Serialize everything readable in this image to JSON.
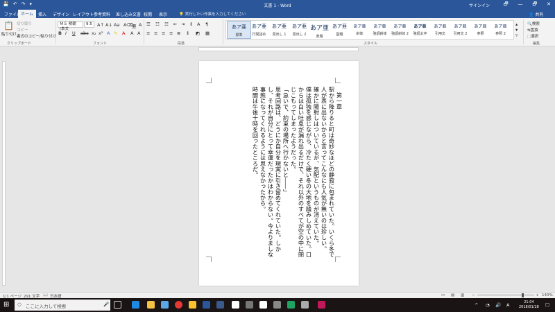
{
  "window": {
    "title": "文書 1 - Word",
    "signin": "サインイン",
    "share_label": "共有"
  },
  "quick_access": [
    "💾",
    "↶",
    "↷",
    "▾"
  ],
  "window_buttons": [
    "🗗",
    "—",
    "🗗",
    "✕"
  ],
  "tabs": [
    "ファイル",
    "ホーム",
    "挿入",
    "デザイン",
    "レイアウト",
    "参考資料",
    "差し込み文書",
    "校閲",
    "表示"
  ],
  "tell_me": "実行したい作業を入力してください",
  "ribbon": {
    "clipboard": {
      "paste": "貼り付け",
      "cut": "切り取り",
      "copy": "コピー",
      "format_painter": "書式のコピー/貼り付け",
      "group": "クリップボード"
    },
    "font": {
      "name": "ＭＳ 明朝 (本文",
      "size": "9.5",
      "group": "フォント"
    },
    "paragraph": {
      "group": "段落"
    },
    "styles": {
      "group": "スタイル",
      "items": [
        {
          "sample": "あア亜",
          "name": "標準"
        },
        {
          "sample": "あア亜",
          "name": "行間詰め"
        },
        {
          "sample": "あア亜",
          "name": "見出し 1"
        },
        {
          "sample": "あア亜",
          "name": "見出し 2"
        },
        {
          "sample": "あア亜",
          "name": "表題"
        },
        {
          "sample": "あア亜",
          "name": "副題"
        },
        {
          "sample": "あア亜",
          "name": "斜体"
        },
        {
          "sample": "あア亜",
          "name": "強調斜体"
        },
        {
          "sample": "あア亜",
          "name": "強調斜体 2"
        },
        {
          "sample": "あア亜",
          "name": "強調太字"
        },
        {
          "sample": "あア亜",
          "name": "引用文"
        },
        {
          "sample": "あア亜",
          "name": "引用文 2"
        },
        {
          "sample": "あア亜",
          "name": "参照"
        },
        {
          "sample": "あア亜",
          "name": "参照 2"
        }
      ]
    },
    "editing": {
      "find": "検索",
      "replace": "置換",
      "select": "選択",
      "group": "編集"
    }
  },
  "document": {
    "heading": "第一章",
    "paragraphs": [
      "駅から降りると町は奇妙なほどの静寂に包まれていた。いくら冬で人が表に出ないからと言ってこんなにも人気が無いのは珍しい。",
      "確かに陽射しはついているが、気配というものが消えていた。",
      "僕は孤独を感じながら、冷たく硬い冬の大地を踏みしめていた。口からは白い吐息が漏れ出るだけで、それ以外のすべてが空の中に閉じこもってしまったようだった。",
      "「急いで、約束の場所へ行かないと――」",
      "思考回路は、どうにか自分を現実に引き留めてくれていた。しかし、それが自分にとって幸運だったかはわからない。今よりましな事態になってくれるようには思えなかったから。",
      "時間は午後十時を回ったところだ。"
    ]
  },
  "status": {
    "page": "1/1 ページ",
    "words": "291 文字",
    "language": "日本語",
    "zoom": "140%"
  },
  "taskbar": {
    "search_placeholder": "ここに入力して検索",
    "time": "21:04",
    "date": "2018/01/28"
  },
  "colors": {
    "word_blue": "#2b579a",
    "ribbon_bg": "#f3f3f3",
    "taskbar_bg": "#1a1414"
  }
}
